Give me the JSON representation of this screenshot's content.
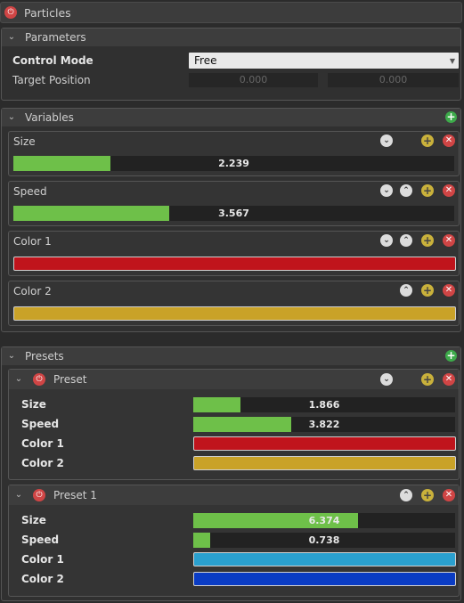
{
  "title": "Particles",
  "parameters": {
    "header": "Parameters",
    "control_mode_label": "Control Mode",
    "control_mode_value": "Free",
    "target_position_label": "Target Position",
    "target_x": "0.000",
    "target_y": "0.000"
  },
  "variables": {
    "header": "Variables",
    "items": [
      {
        "label": "Size",
        "value": "2.239",
        "fill": 0.22
      },
      {
        "label": "Speed",
        "value": "3.567",
        "fill": 0.353
      },
      {
        "label": "Color 1",
        "color": "#c0141c"
      },
      {
        "label": "Color 2",
        "color": "#c9a228"
      }
    ]
  },
  "presets": {
    "header": "Presets",
    "items": [
      {
        "name": "Preset",
        "rows": [
          {
            "label": "Size",
            "value": "1.866",
            "fill": 0.18
          },
          {
            "label": "Speed",
            "value": "3.822",
            "fill": 0.375
          },
          {
            "label": "Color 1",
            "color": "#c0141c"
          },
          {
            "label": "Color 2",
            "color": "#c9a228"
          }
        ]
      },
      {
        "name": "Preset 1",
        "rows": [
          {
            "label": "Size",
            "value": "6.374",
            "fill": 0.63
          },
          {
            "label": "Speed",
            "value": "0.738",
            "fill": 0.065
          },
          {
            "label": "Color 1",
            "color": "#2aa0cf"
          },
          {
            "label": "Color 2",
            "color": "#0a3cc4"
          }
        ]
      }
    ]
  },
  "colors": {
    "slider_fill": "#6ec049",
    "add": "#3daa4a",
    "remove": "#d04545",
    "move": "#c9b13b"
  }
}
